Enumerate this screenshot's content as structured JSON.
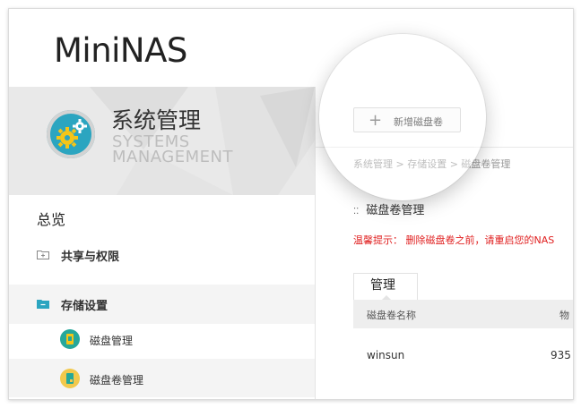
{
  "app": {
    "logo": "MiniNAS"
  },
  "sidebar": {
    "banner": {
      "title": "系统管理",
      "subtitle_line1": "SYSTEMS",
      "subtitle_line2": "MANAGEMENT"
    },
    "overview": "总览",
    "items": [
      {
        "label": "共享与权限",
        "icon": "folder-plus-icon"
      },
      {
        "label": "存储设置",
        "icon": "folder-minus-icon"
      }
    ],
    "sub_items": [
      {
        "label": "磁盘管理",
        "icon": "disk-icon"
      },
      {
        "label": "磁盘卷管理",
        "icon": "volume-icon"
      }
    ]
  },
  "main": {
    "add_button": "新增磁盘卷",
    "breadcrumb": "系统管理 > 存储设置 > 磁盘卷管理",
    "section_title": "磁盘卷管理",
    "warning": "温馨提示：  删除磁盘卷之前，请重启您的NAS",
    "tab": "管理",
    "table": {
      "headers": [
        "磁盘卷名称",
        "物"
      ],
      "rows": [
        [
          "winsun",
          "935"
        ]
      ]
    }
  },
  "colors": {
    "accent": "#2ba5c0",
    "warning": "#e02020",
    "disk": "#26a89a",
    "volume": "#f2c94c"
  }
}
